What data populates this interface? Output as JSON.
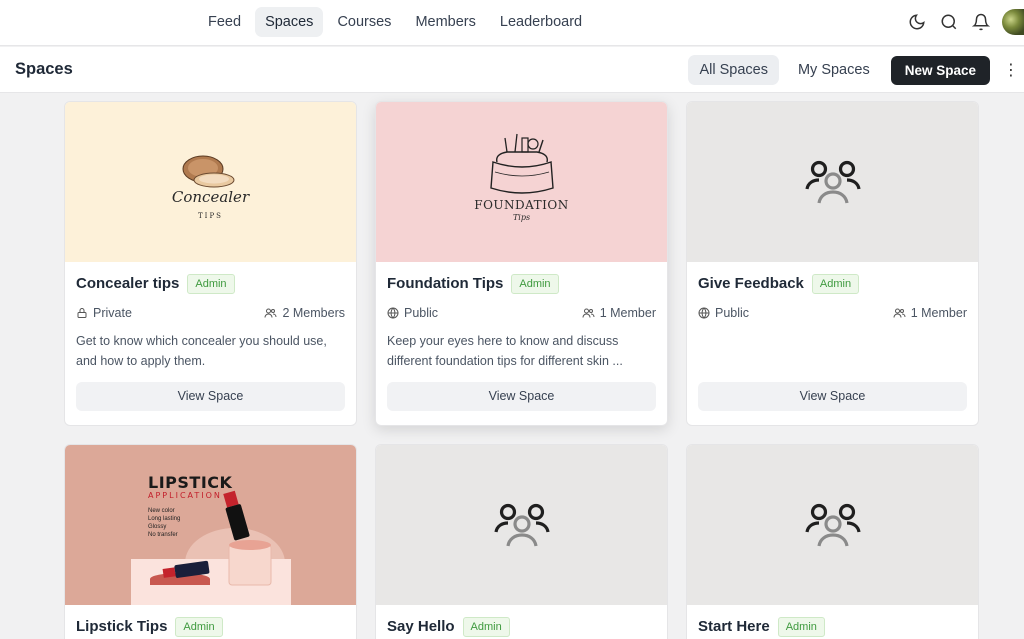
{
  "nav": {
    "tabs": [
      "Feed",
      "Spaces",
      "Courses",
      "Members",
      "Leaderboard"
    ],
    "active": "Spaces",
    "icons": [
      "moon-icon",
      "search-icon",
      "bell-icon",
      "avatar"
    ]
  },
  "subheader": {
    "title": "Spaces",
    "filters": [
      "All Spaces",
      "My Spaces"
    ],
    "active_filter": "All Spaces",
    "new_button": "New Space",
    "more_icon": "more-vertical-icon"
  },
  "cards": [
    {
      "name": "Concealer tips",
      "badge": "Admin",
      "privacy": "Private",
      "members": "2 Members",
      "desc": "Get to know which concealer you should use, and how to apply them.",
      "cover_text_1": "Concealer",
      "cover_text_2": "TIPS",
      "view": "View Space",
      "cover_color": "#fdf1d9"
    },
    {
      "name": "Foundation Tips",
      "badge": "Admin",
      "privacy": "Public",
      "members": "1 Member",
      "desc": "Keep your eyes here to know and discuss different foundation tips for different skin ...",
      "cover_text_1": "FOUNDATION",
      "cover_text_2": "Tips",
      "view": "View Space",
      "cover_color": "#f5d3d3"
    },
    {
      "name": "Give Feedback",
      "badge": "Admin",
      "privacy": "Public",
      "members": "1 Member",
      "desc": "",
      "view": "View Space",
      "cover_color": "#e8e7e6"
    },
    {
      "name": "Lipstick Tips",
      "badge": "Admin",
      "cover_text_1": "LIPSTICK",
      "cover_text_2": "APPLICATION",
      "cover_bullets": [
        "New color",
        "Long lasting",
        "Glossy",
        "No transfer"
      ],
      "cover_color": "#dca898"
    },
    {
      "name": "Say Hello",
      "badge": "Admin",
      "cover_color": "#e8e7e6"
    },
    {
      "name": "Start Here",
      "badge": "Admin",
      "cover_color": "#e8e7e6"
    }
  ],
  "colors": {
    "primary_button": "#1f2328",
    "badge_text": "#3f9a3f",
    "badge_bg": "#eef8ea",
    "page_bg": "#f1f1f2"
  }
}
